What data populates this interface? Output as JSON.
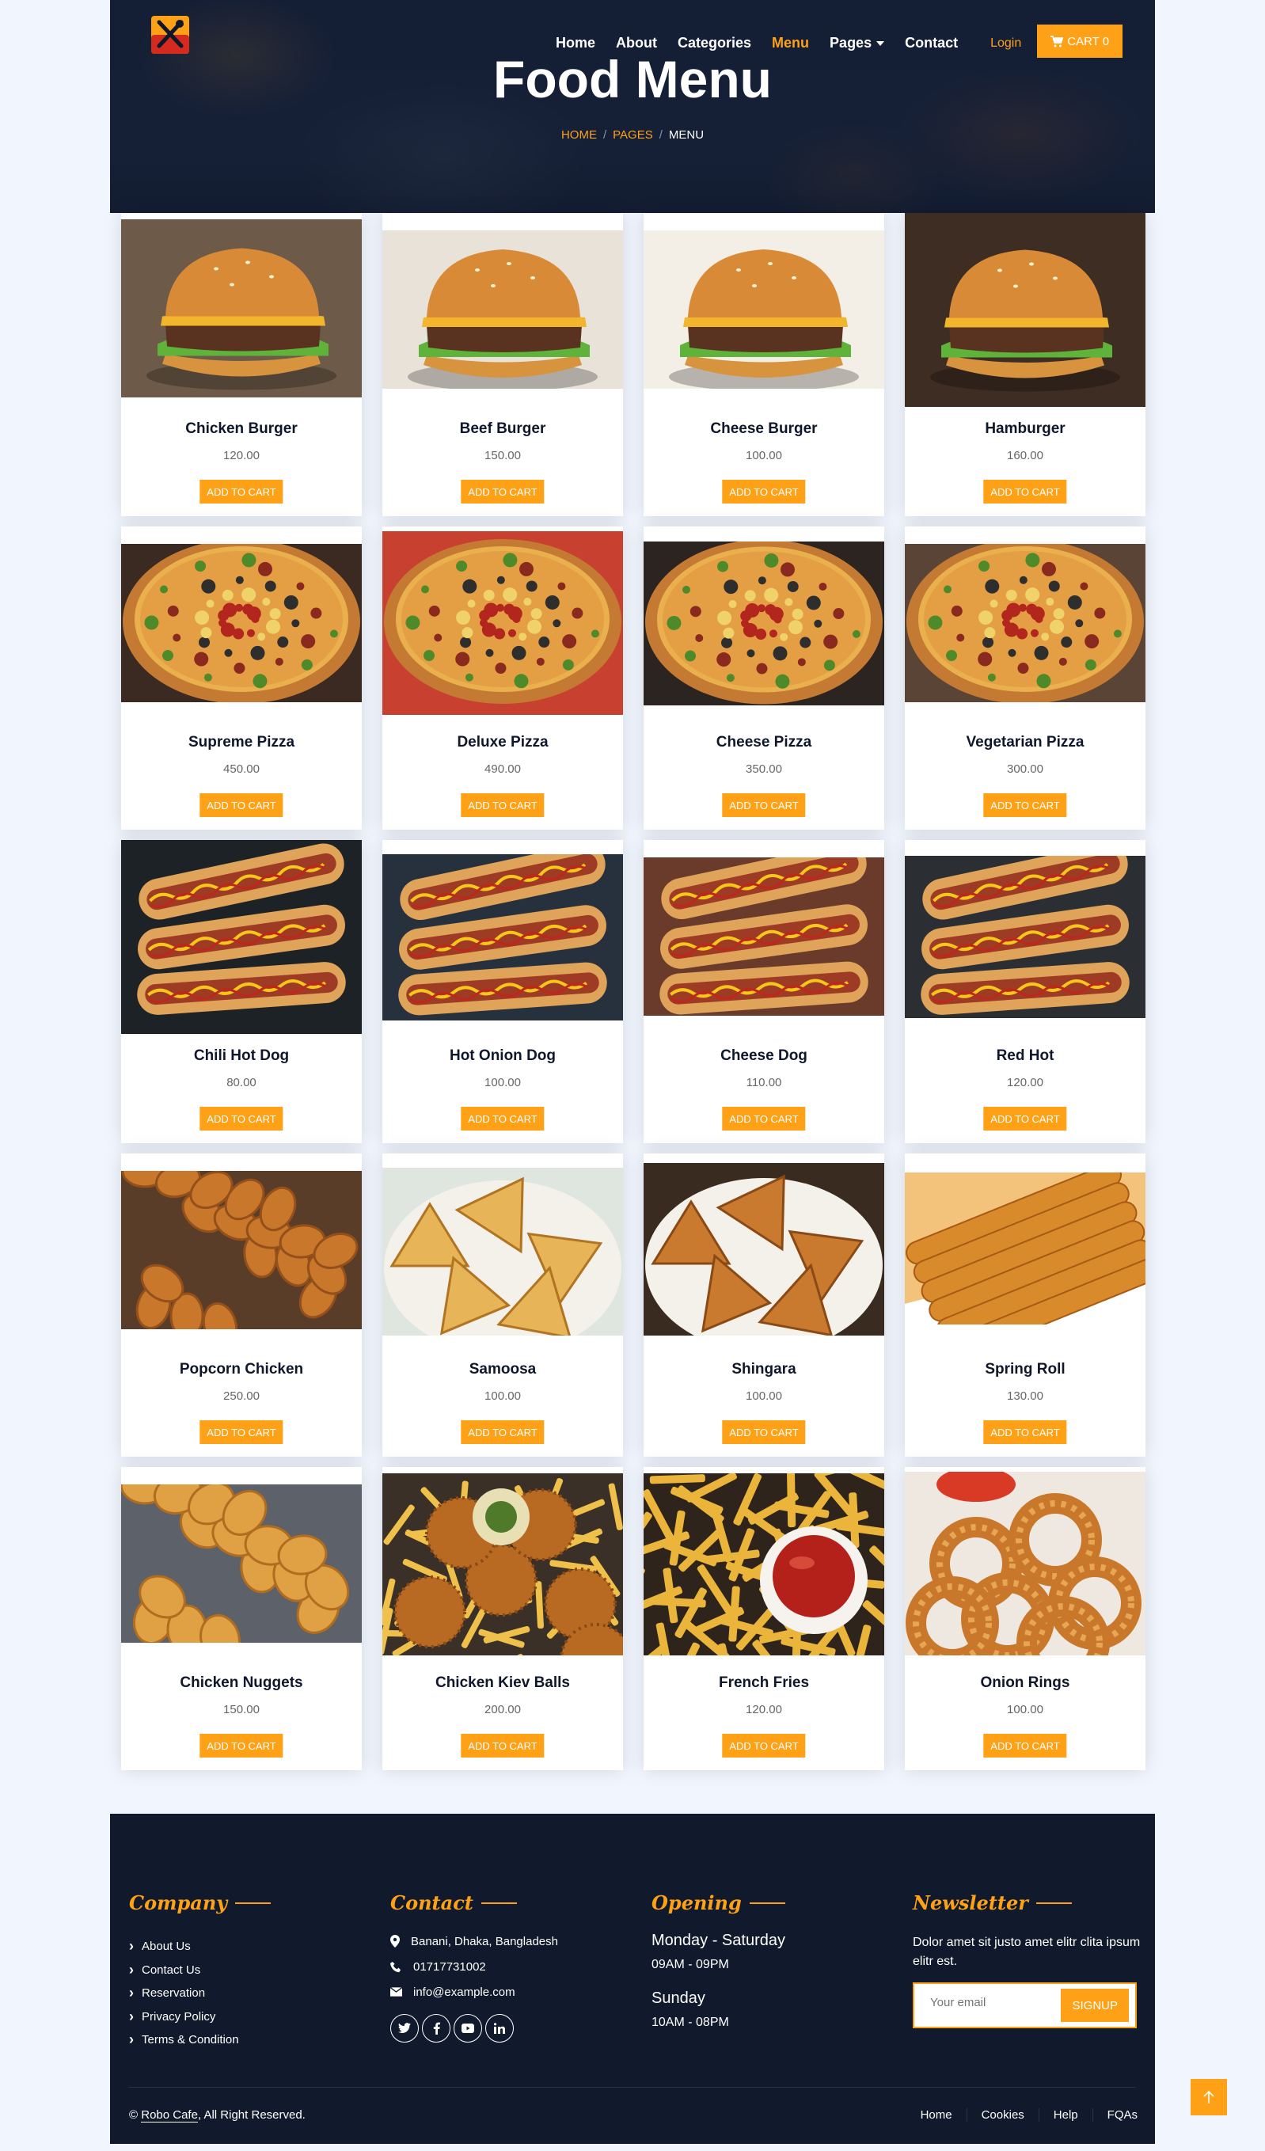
{
  "nav": {
    "home": "Home",
    "about": "About",
    "categories": "Categories",
    "menu": "Menu",
    "pages": "Pages",
    "contact": "Contact",
    "login": "Login",
    "cart": "CART 0"
  },
  "hero": {
    "title": "Food Menu",
    "crumbs": [
      "HOME",
      "PAGES",
      "MENU"
    ]
  },
  "add_label": "ADD TO CART",
  "items": [
    {
      "name": "Chicken Burger",
      "price": "120.00"
    },
    {
      "name": "Beef Burger",
      "price": "150.00"
    },
    {
      "name": "Cheese Burger",
      "price": "100.00"
    },
    {
      "name": "Hamburger",
      "price": "160.00"
    },
    {
      "name": "Supreme Pizza",
      "price": "450.00"
    },
    {
      "name": "Deluxe Pizza",
      "price": "490.00"
    },
    {
      "name": "Cheese Pizza",
      "price": "350.00"
    },
    {
      "name": "Vegetarian Pizza",
      "price": "300.00"
    },
    {
      "name": "Chili Hot Dog",
      "price": "80.00"
    },
    {
      "name": "Hot Onion Dog",
      "price": "100.00"
    },
    {
      "name": "Cheese Dog",
      "price": "110.00"
    },
    {
      "name": "Red Hot",
      "price": "120.00"
    },
    {
      "name": "Popcorn Chicken",
      "price": "250.00"
    },
    {
      "name": "Samoosa",
      "price": "100.00"
    },
    {
      "name": "Shingara",
      "price": "100.00"
    },
    {
      "name": "Spring Roll",
      "price": "130.00"
    },
    {
      "name": "Chicken Nuggets",
      "price": "150.00"
    },
    {
      "name": "Chicken Kiev Balls",
      "price": "200.00"
    },
    {
      "name": "French Fries",
      "price": "120.00"
    },
    {
      "name": "Onion Rings",
      "price": "100.00"
    }
  ],
  "footer": {
    "company": {
      "title": "Company",
      "links": [
        "About Us",
        "Contact Us",
        "Reservation",
        "Privacy Policy",
        "Terms & Condition"
      ]
    },
    "contact": {
      "title": "Contact",
      "address": "Banani, Dhaka, Bangladesh",
      "phone": "01717731002",
      "email": "info@example.com"
    },
    "opening": {
      "title": "Opening",
      "day1": "Monday - Saturday",
      "time1": "09AM - 09PM",
      "day2": "Sunday",
      "time2": "10AM - 08PM"
    },
    "newsletter": {
      "title": "Newsletter",
      "text": "Dolor amet sit justo amet elitr clita ipsum elitr est.",
      "placeholder": "Your email",
      "button": "SIGNUP"
    },
    "copyright_prefix": "© ",
    "brand": "Robo Cafe",
    "copyright_suffix": ", All Right Reserved.",
    "bottom_links": [
      "Home",
      "Cookies",
      "Help",
      "FQAs"
    ]
  },
  "colors": {
    "accent": "#fea116",
    "dark": "#0f172b",
    "background": "#f1f6fe"
  }
}
